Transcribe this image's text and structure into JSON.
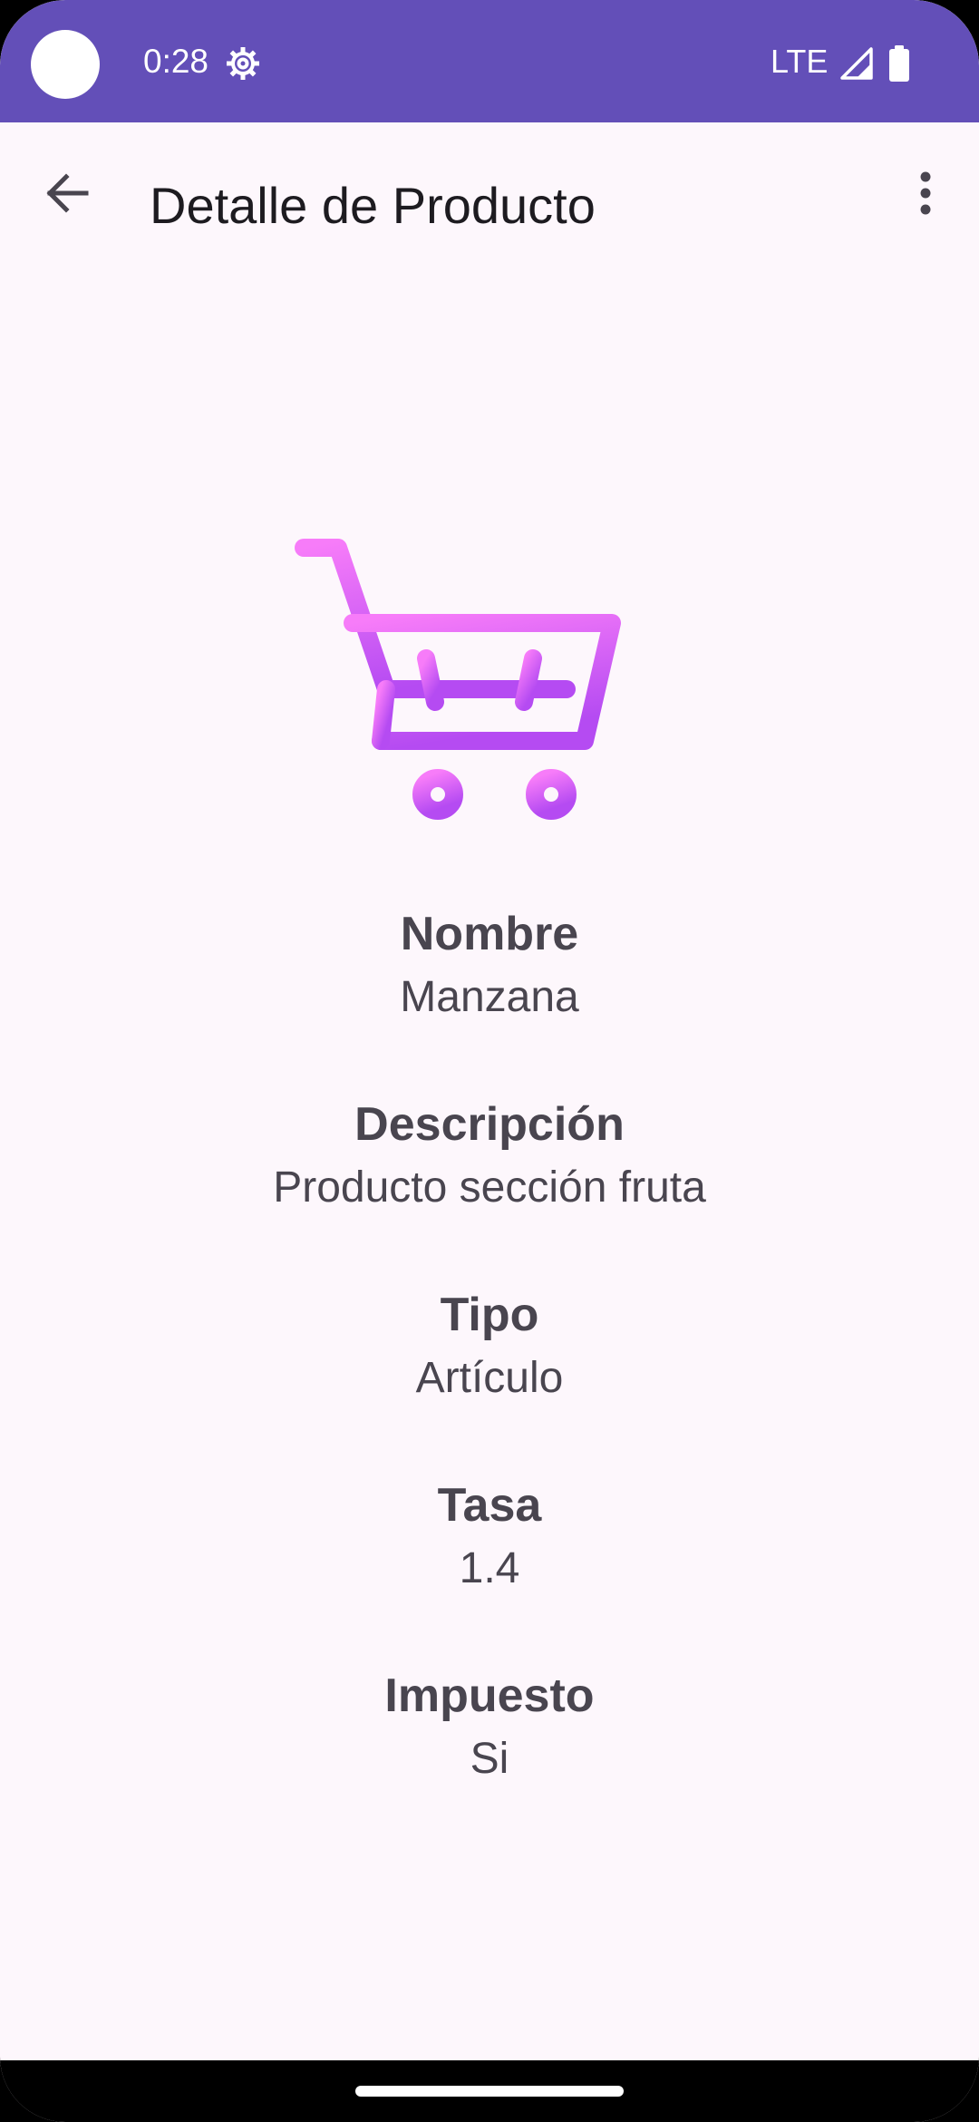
{
  "status_bar": {
    "time": "0:28",
    "network": "LTE",
    "icons": [
      "settings-gear-icon",
      "signal-icon",
      "battery-icon"
    ],
    "color": "#634FB8"
  },
  "app_bar": {
    "title": "Detalle de Producto",
    "back_icon": "arrow-back-icon",
    "menu_icon": "more-vert-icon"
  },
  "product": {
    "image_icon": "shopping-cart-icon",
    "gradient_colors": [
      "#F77CF9",
      "#B54BF2"
    ],
    "fields": [
      {
        "label": "Nombre",
        "value": "Manzana"
      },
      {
        "label": "Descripción",
        "value": "Producto sección fruta"
      },
      {
        "label": "Tipo",
        "value": "Artículo"
      },
      {
        "label": "Tasa",
        "value": "1.4"
      },
      {
        "label": "Impuesto",
        "value": "Si"
      }
    ]
  },
  "theme": {
    "background": "#FDF7FC",
    "text_primary": "#1D1B20",
    "text_secondary": "#49454F"
  }
}
